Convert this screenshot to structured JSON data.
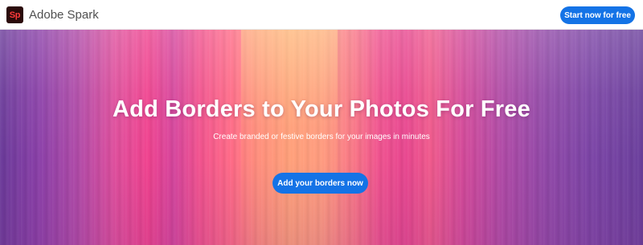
{
  "header": {
    "brand": {
      "logo_text": "Sp",
      "logo_icon": "adobe-spark-logo-icon",
      "name": "Adobe Spark"
    },
    "start_button_label": "Start now for free"
  },
  "hero": {
    "title": "Add Borders to Your Photos For Free",
    "subtitle": "Create branded or festive borders for your images in minutes",
    "cta_label": "Add your borders now"
  },
  "colors": {
    "accent": "#1473e6",
    "logo_background": "#2b0b0b",
    "logo_text": "#ff3b3b"
  }
}
